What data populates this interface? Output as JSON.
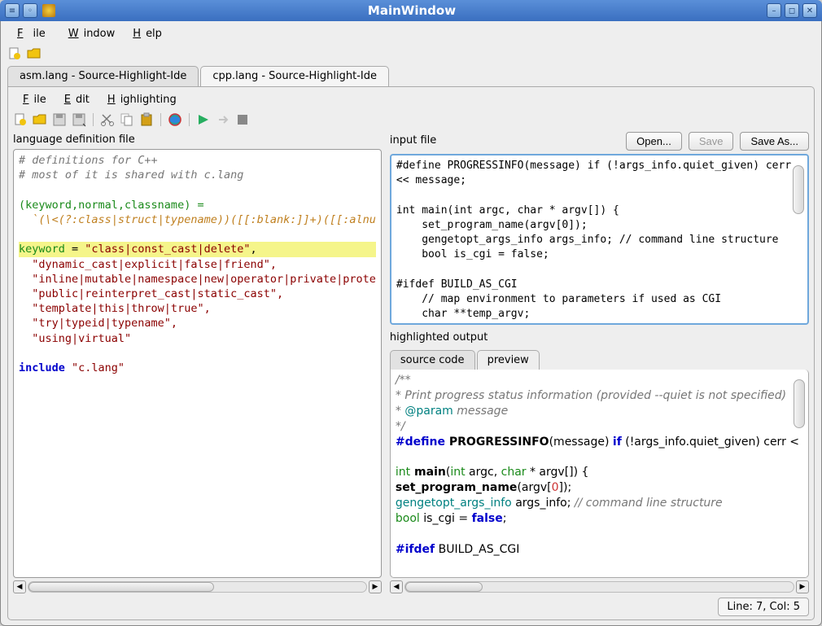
{
  "window": {
    "title": "MainWindow"
  },
  "menubar": {
    "file": "File",
    "window": "Window",
    "help": "Help"
  },
  "tabs": [
    {
      "label": "asm.lang - Source-Highlight-Ide",
      "active": false
    },
    {
      "label": "cpp.lang - Source-Highlight-Ide",
      "active": true
    }
  ],
  "inner_menubar": {
    "file": "File",
    "edit": "Edit",
    "highlighting": "Highlighting"
  },
  "left": {
    "label": "language definition file",
    "code": {
      "l1": "# definitions for C++",
      "l2": "# most of it is shared with c.lang",
      "l4a": "(keyword,normal,classname) =",
      "l5": "  `(\\<(?:class|struct|typename))([[:blank:]]+)([[:alnu",
      "l7a": "keyword",
      "l7b": " = ",
      "l7c": "\"class|const_cast|delete\"",
      "l7d": ",",
      "l8": "  \"dynamic_cast|explicit|false|friend\",",
      "l9": "  \"inline|mutable|namespace|new|operator|private|prote",
      "l10": "  \"public|reinterpret_cast|static_cast\",",
      "l11": "  \"template|this|throw|true\",",
      "l12": "  \"try|typeid|typename\",",
      "l13": "  \"using|virtual\"",
      "l15a": "include",
      "l15b": " \"c.lang\""
    }
  },
  "right": {
    "input_label": "input file",
    "buttons": {
      "open": "Open...",
      "save": "Save",
      "save_as": "Save As..."
    },
    "input_code": {
      "l1": "#define PROGRESSINFO(message) if (!args_info.quiet_given) cerr",
      "l2": "<< message;",
      "l4": "int main(int argc, char * argv[]) {",
      "l5": "    set_program_name(argv[0]);",
      "l6": "    gengetopt_args_info args_info; // command line structure",
      "l7": "    bool is_cgi = false;",
      "l9": "#ifdef BUILD_AS_CGI",
      "l10": "    // map environment to parameters if used as CGI",
      "l11": "    char **temp_argv;"
    },
    "output_label": "highlighted output",
    "subtabs": {
      "source": "source code",
      "preview": "preview"
    },
    "preview": {
      "l1": "/**",
      "l2": " * Print progress status information (provided --quiet is not specified)",
      "l3a": " * ",
      "l3b": "@param",
      "l3c": " message",
      "l4": " */",
      "l5a": "#define",
      "l5b": " PROGRESSINFO",
      "l5c": "(message) ",
      "l5d": "if",
      "l5e": " (!args_info.quiet_given) cerr <",
      "l7a": "int",
      "l7b": " main",
      "l7c": "(",
      "l7d": "int",
      "l7e": " argc, ",
      "l7f": "char",
      "l7g": " * argv[]) {",
      "l8a": "    set_program_name",
      "l8b": "(argv[",
      "l8c": "0",
      "l8d": "]);",
      "l9a": "    gengetopt_args_info",
      "l9b": " args_info; ",
      "l9c": "// command line structure",
      "l10a": "    bool",
      "l10b": " is_cgi = ",
      "l10c": "false",
      "l10d": ";",
      "l12a": "#ifdef",
      "l12b": " BUILD_AS_CGI"
    }
  },
  "status": {
    "text": "Line: 7, Col: 5"
  },
  "icons": {
    "new": "new-file-icon",
    "open": "open-folder-icon"
  }
}
